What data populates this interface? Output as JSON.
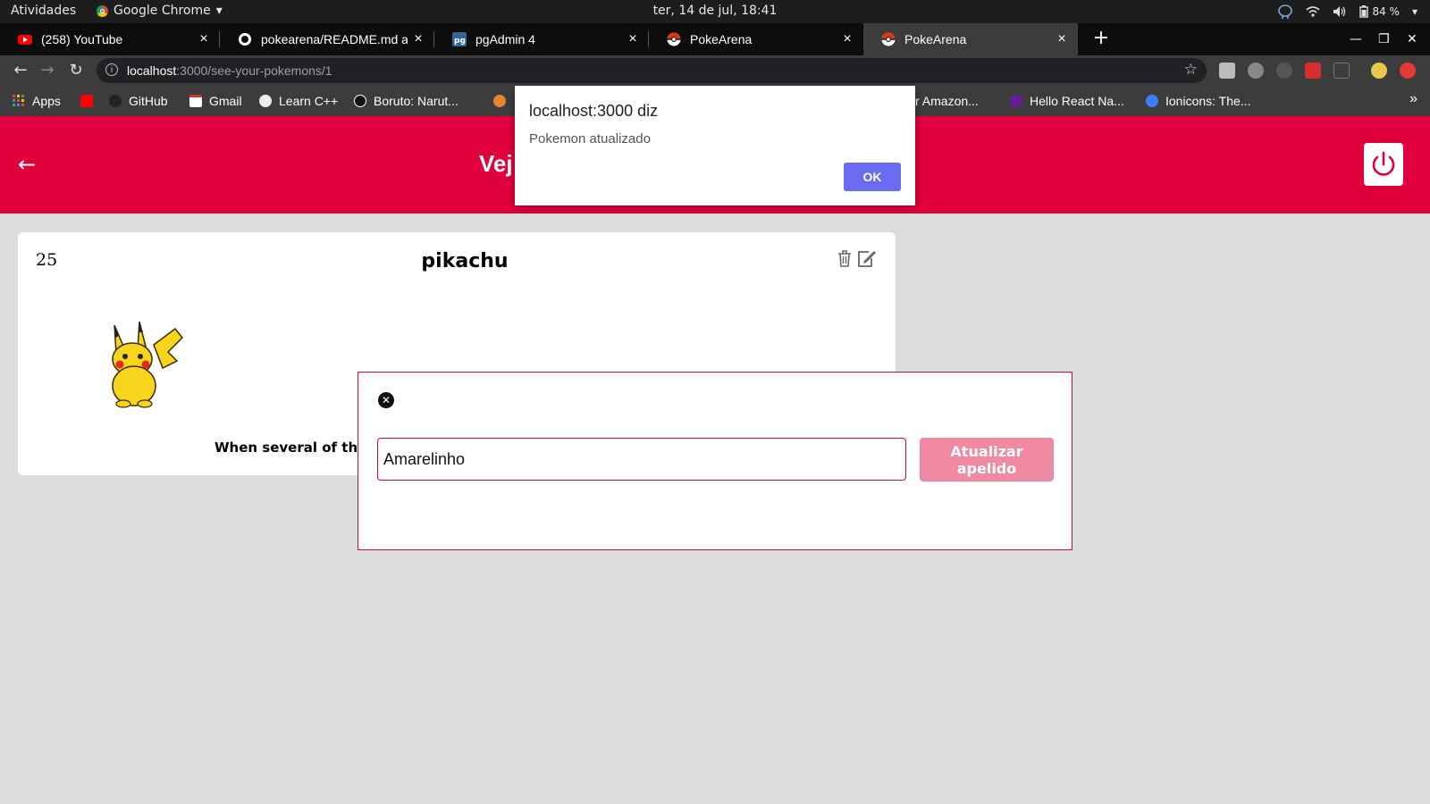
{
  "system": {
    "activities": "Atividades",
    "app_name": "Google Chrome",
    "clock": "ter, 14 de jul, 18:41",
    "battery": "84 %"
  },
  "tabs": [
    {
      "label": "(258) YouTube",
      "close": "×"
    },
    {
      "label": "pokearena/README.md a",
      "close": "×"
    },
    {
      "label": "pgAdmin 4",
      "close": "×"
    },
    {
      "label": "PokeArena",
      "close": "×"
    },
    {
      "label": "PokeArena",
      "close": "×"
    }
  ],
  "new_tab": "+",
  "window_controls": {
    "minimize": "—",
    "maximize": "❐",
    "close": "✕"
  },
  "address": {
    "host": "localhost",
    "path": ":3000/see-your-pokemons/1",
    "info_symbol": "i",
    "star_symbol": "☆"
  },
  "nav": {
    "back": "←",
    "forward": "→",
    "reload": "↻"
  },
  "bookmarks": [
    {
      "label": "Apps"
    },
    {
      "label": ""
    },
    {
      "label": "GitHub"
    },
    {
      "label": "Gmail"
    },
    {
      "label": "Learn C++"
    },
    {
      "label": "Boruto: Narut..."
    },
    {
      "label": "r Amazon..."
    },
    {
      "label": "Hello React Na..."
    },
    {
      "label": "Ionicons: The..."
    }
  ],
  "bookmarks_more": "»",
  "colors": {
    "brand": "#e0003d",
    "ok_button": "#6b6bf0",
    "update_button": "#f08aa3"
  },
  "header": {
    "back_symbol": "←",
    "title": "Vej"
  },
  "card": {
    "id": "25",
    "name": "pikachu",
    "description": "When several of thes"
  },
  "modal": {
    "close_symbol": "✕",
    "nickname_value": "Amarelinho",
    "update_label": "Atualizar apelido"
  },
  "alert": {
    "title": "localhost:3000 diz",
    "message": "Pokemon atualizado",
    "ok_label": "OK"
  }
}
